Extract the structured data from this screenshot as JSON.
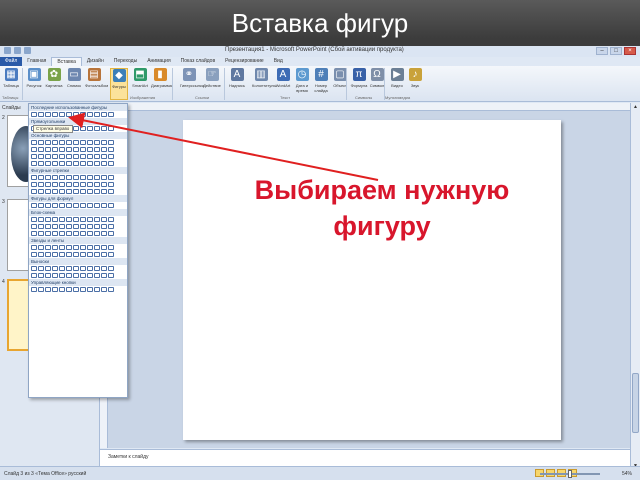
{
  "slide": {
    "title": "Вставка фигур",
    "callout_line1": "Выбираем нужную",
    "callout_line2": "фигуру"
  },
  "window": {
    "title": "Презентация1 - Microsoft PowerPoint (Сбой активации продукта)"
  },
  "tabs": [
    {
      "label": "Файл"
    },
    {
      "label": "Главная"
    },
    {
      "label": "Вставка"
    },
    {
      "label": "Дизайн"
    },
    {
      "label": "Переходы"
    },
    {
      "label": "Анимация"
    },
    {
      "label": "Показ слайдов"
    },
    {
      "label": "Рецензирование"
    },
    {
      "label": "Вид"
    }
  ],
  "ribbon": {
    "buttons": [
      {
        "label": "Таблица",
        "icon": "table-icon"
      },
      {
        "label": "Рисунок",
        "icon": "picture-icon"
      },
      {
        "label": "Картинка",
        "icon": "clipart-icon"
      },
      {
        "label": "Снимок",
        "icon": "screenshot-icon"
      },
      {
        "label": "Фотоальбом",
        "icon": "photoalbum-icon"
      },
      {
        "label": "Фигуры",
        "icon": "shapes-icon"
      },
      {
        "label": "SmartArt",
        "icon": "smartart-icon"
      },
      {
        "label": "Диаграмма",
        "icon": "chart-icon"
      },
      {
        "label": "Гиперссылка",
        "icon": "hyperlink-icon"
      },
      {
        "label": "Действие",
        "icon": "action-icon"
      },
      {
        "label": "Надпись",
        "icon": "textbox-icon"
      },
      {
        "label": "Колонтитулы",
        "icon": "header-footer-icon"
      },
      {
        "label": "WordArt",
        "icon": "wordart-icon"
      },
      {
        "label": "Дата и время",
        "icon": "datetime-icon"
      },
      {
        "label": "Номер слайда",
        "icon": "slidenumber-icon"
      },
      {
        "label": "Объект",
        "icon": "object-icon"
      },
      {
        "label": "Формула",
        "icon": "equation-icon"
      },
      {
        "label": "Символ",
        "icon": "symbol-icon"
      },
      {
        "label": "Видео",
        "icon": "video-icon"
      },
      {
        "label": "Звук",
        "icon": "audio-icon"
      }
    ],
    "groups": [
      {
        "label": "Таблицы"
      },
      {
        "label": "Изображения"
      },
      {
        "label": "Ссылки"
      },
      {
        "label": "Текст"
      },
      {
        "label": "Символы"
      },
      {
        "label": "Мультимедиа"
      }
    ]
  },
  "left_panel": {
    "tab_label": "Слайды",
    "slide_numbers": [
      "2",
      "3",
      "4"
    ]
  },
  "shapes_menu": {
    "sections": [
      {
        "title": "Последние использованные фигуры"
      },
      {
        "title": "Прямоугольники"
      },
      {
        "title": "Основные фигуры"
      },
      {
        "title": "Фигурные стрелки"
      },
      {
        "title": "Фигуры для формул"
      },
      {
        "title": "Блок-схема"
      },
      {
        "title": "Звезды и ленты"
      },
      {
        "title": "Выноски"
      },
      {
        "title": "Управляющие кнопки"
      }
    ],
    "tooltip": "Стрелка вправо"
  },
  "notes": {
    "placeholder": "Заметки к слайду"
  },
  "statusbar": {
    "text": "Слайд 3 из 3   «Тема Office»   русский",
    "zoom": "54%"
  },
  "colors": {
    "callout": "#d8162c",
    "arrow": "#e02020",
    "selected_button": "#fbe29a"
  }
}
